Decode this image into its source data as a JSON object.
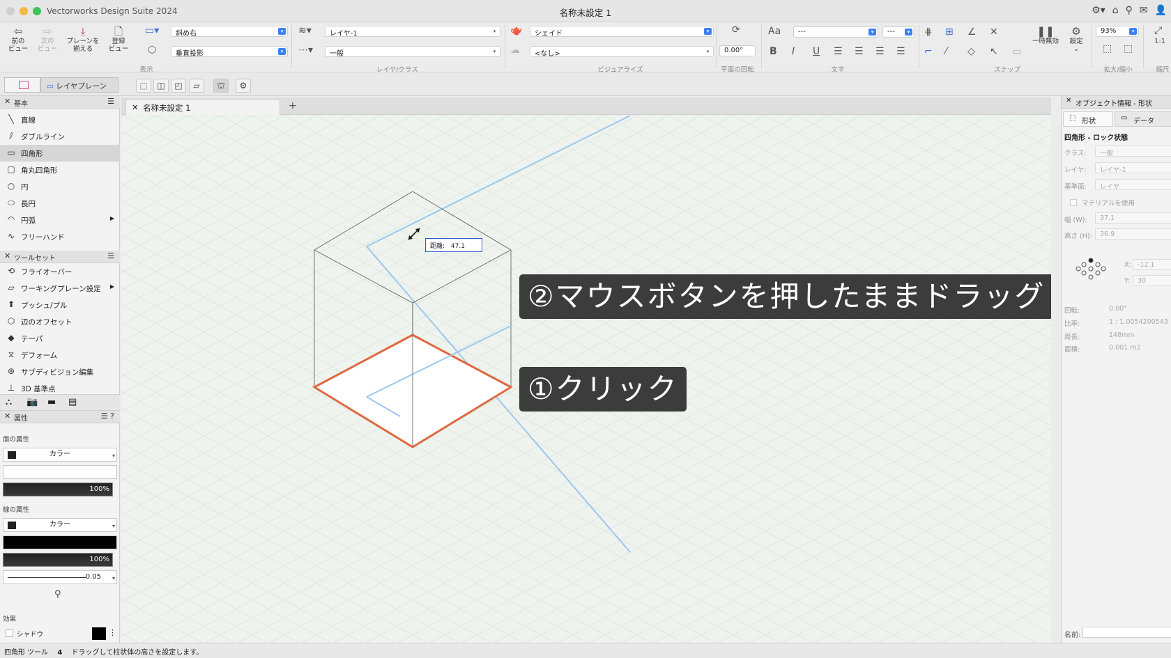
{
  "titlebar": {
    "app_name": "Vectorworks Design Suite 2024",
    "doc_title": "名称未設定 1",
    "colors": {
      "close": "#fe5f57",
      "minimize": "#febc2e",
      "zoom": "#28c840"
    }
  },
  "toolbar": {
    "prev_view": "前の\nビュー",
    "next_view": "次の\nビュー",
    "align_plane": "プレーンを\n揃える",
    "saved_view": "登録\nビュー",
    "view_select": "斜め右",
    "projection_select": "垂直投影",
    "group_display": "表示",
    "layer_select": "レイヤ-1",
    "class_select": "一般",
    "group_layer_class": "レイヤ/クラス",
    "render_select": "シェイド",
    "light_select": "<なし>",
    "group_visualize": "ビジュアライズ",
    "rotation_value": "0.00°",
    "group_plane_rotation": "平面の回転",
    "font_label": "Aa",
    "font_select": "---",
    "size_select": "---",
    "bold": "B",
    "italic": "I",
    "underline": "U",
    "group_text": "文字",
    "group_snap": "スナップ",
    "pause_label": "一時無効",
    "settings_label": "設定",
    "zoom_select": "93%",
    "group_zoom": "拡大/縮小",
    "scale_label": "1:1",
    "group_scale": "縮尺"
  },
  "modebar": {
    "layer_plane_label": "レイヤプレーン"
  },
  "basic_palette": {
    "title": "基本",
    "items": [
      {
        "label": "直線",
        "icon": "line-icon"
      },
      {
        "label": "ダブルライン",
        "icon": "double-line-icon"
      },
      {
        "label": "四角形",
        "icon": "rectangle-icon"
      },
      {
        "label": "角丸四角形",
        "icon": "rounded-rectangle-icon"
      },
      {
        "label": "円",
        "icon": "circle-icon"
      },
      {
        "label": "長円",
        "icon": "oval-icon"
      },
      {
        "label": "円弧",
        "icon": "arc-icon"
      },
      {
        "label": "フリーハンド",
        "icon": "freehand-icon"
      }
    ]
  },
  "toolset_palette": {
    "title": "ツールセット",
    "items": [
      {
        "label": "フライオーバー",
        "icon": "flyover-icon"
      },
      {
        "label": "ワーキングプレーン設定",
        "icon": "working-plane-icon"
      },
      {
        "label": "プッシュ/プル",
        "icon": "push-pull-icon"
      },
      {
        "label": "辺のオフセット",
        "icon": "offset-edge-icon"
      },
      {
        "label": "テーパ",
        "icon": "taper-icon"
      },
      {
        "label": "デフォーム",
        "icon": "deform-icon"
      },
      {
        "label": "サブディビジョン編集",
        "icon": "subdivision-icon"
      },
      {
        "label": "3D 基準点",
        "icon": "3d-locus-icon"
      }
    ]
  },
  "attributes_palette": {
    "title": "属性",
    "fill_label": "面の属性",
    "fill_type": "カラー",
    "fill_opacity": "100%",
    "line_label": "線の属性",
    "line_type": "カラー",
    "line_opacity": "100%",
    "line_weight": "0.05",
    "effects_label": "効果",
    "shadow_label": "シャドウ"
  },
  "document": {
    "tab_label": "名称未設定 1",
    "add_tab": "+"
  },
  "canvas": {
    "distance_label": "距離:",
    "distance_value": "47.1",
    "callout_drag": "②マウスボタンを押したままドラッグ",
    "callout_click": "①クリック",
    "highlight_color": "#e0683f"
  },
  "obj_info": {
    "title": "オブジェクト情報 - 形状",
    "tab_shape": "形状",
    "tab_data": "データ",
    "object_title": "四角形 - ロック状態",
    "class_label": "クラス:",
    "class_value": "一般",
    "layer_label": "レイヤ:",
    "layer_value": "レイヤ-1",
    "plane_label": "基準面:",
    "plane_value": "レイヤ",
    "material_label": "マテリアルを使用",
    "width_label": "幅 (W):",
    "width_value": "37.1",
    "height_label": "高さ (H):",
    "height_value": "36.9",
    "x_label": "X:",
    "x_value": "-12.1",
    "y_label": "Y:",
    "y_value": "30",
    "rot_label": "回転:",
    "rot_value": "0.00°",
    "ratio_label": "比率:",
    "ratio_value": "1 : 1.0054200543",
    "perimeter_label": "周長:",
    "perimeter_value": "148mm",
    "area_label": "面積:",
    "area_value": "0.001 m2",
    "name_label": "名前:"
  },
  "statusbar": {
    "tool_name": "四角形 ツール",
    "step": "4",
    "hint": "ドラッグして柱状体の高さを設定します。"
  }
}
